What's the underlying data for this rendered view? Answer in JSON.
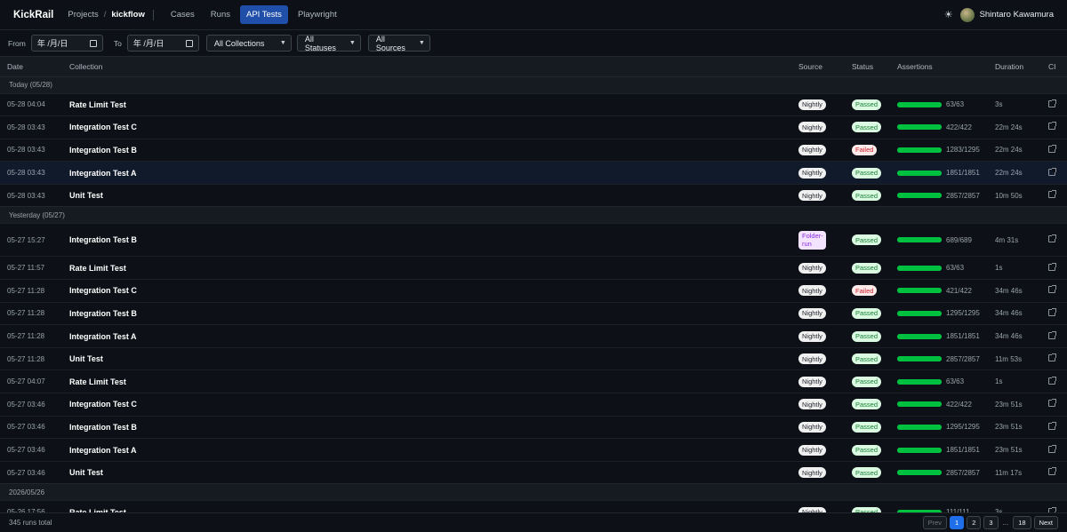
{
  "header": {
    "brand": "KickRail",
    "projects": "Projects",
    "sep": "/",
    "project": "kickflow",
    "nav": [
      "Cases",
      "Runs",
      "API Tests",
      "Playwright"
    ],
    "user": "Shintaro Kawamura"
  },
  "filters": {
    "from_label": "From",
    "from_value": "年 /月/日",
    "to_label": "To",
    "to_value": "年 /月/日",
    "collections": "All Collections",
    "statuses": "All Statuses",
    "sources": "All Sources"
  },
  "columns": [
    "Date",
    "Collection",
    "Source",
    "Status",
    "Assertions",
    "Duration",
    "CI"
  ],
  "groups": [
    {
      "label": "Today (05/28)",
      "rows": [
        {
          "date": "05-28 04:04",
          "collection": "Rate Limit Test",
          "source": "Nightly",
          "status": "Passed",
          "assertions": "63/63",
          "ratio": 1,
          "duration": "3s"
        },
        {
          "date": "05-28 03:43",
          "collection": "Integration Test C",
          "source": "Nightly",
          "status": "Passed",
          "assertions": "422/422",
          "ratio": 1,
          "duration": "22m 24s"
        },
        {
          "date": "05-28 03:43",
          "collection": "Integration Test B",
          "source": "Nightly",
          "status": "Failed",
          "assertions": "1283/1295",
          "ratio": 0.99,
          "duration": "22m 24s"
        },
        {
          "date": "05-28 03:43",
          "collection": "Integration Test A",
          "source": "Nightly",
          "status": "Passed",
          "assertions": "1851/1851",
          "ratio": 1,
          "duration": "22m 24s"
        },
        {
          "date": "05-28 03:43",
          "collection": "Unit Test",
          "source": "Nightly",
          "status": "Passed",
          "assertions": "2857/2857",
          "ratio": 1,
          "duration": "10m 50s"
        }
      ]
    },
    {
      "label": "Yesterday (05/27)",
      "rows": [
        {
          "date": "05-27 15:27",
          "collection": "Integration Test B",
          "source": "Folder-run",
          "status": "Passed",
          "assertions": "689/689",
          "ratio": 1,
          "duration": "4m 31s"
        },
        {
          "date": "05-27 11:57",
          "collection": "Rate Limit Test",
          "source": "Nightly",
          "status": "Passed",
          "assertions": "63/63",
          "ratio": 1,
          "duration": "1s"
        },
        {
          "date": "05-27 11:28",
          "collection": "Integration Test C",
          "source": "Nightly",
          "status": "Failed",
          "assertions": "421/422",
          "ratio": 0.998,
          "duration": "34m 46s"
        },
        {
          "date": "05-27 11:28",
          "collection": "Integration Test B",
          "source": "Nightly",
          "status": "Passed",
          "assertions": "1295/1295",
          "ratio": 1,
          "duration": "34m 46s"
        },
        {
          "date": "05-27 11:28",
          "collection": "Integration Test A",
          "source": "Nightly",
          "status": "Passed",
          "assertions": "1851/1851",
          "ratio": 1,
          "duration": "34m 46s"
        },
        {
          "date": "05-27 11:28",
          "collection": "Unit Test",
          "source": "Nightly",
          "status": "Passed",
          "assertions": "2857/2857",
          "ratio": 1,
          "duration": "11m 53s"
        },
        {
          "date": "05-27 04:07",
          "collection": "Rate Limit Test",
          "source": "Nightly",
          "status": "Passed",
          "assertions": "63/63",
          "ratio": 1,
          "duration": "1s"
        },
        {
          "date": "05-27 03:46",
          "collection": "Integration Test C",
          "source": "Nightly",
          "status": "Passed",
          "assertions": "422/422",
          "ratio": 1,
          "duration": "23m 51s"
        },
        {
          "date": "05-27 03:46",
          "collection": "Integration Test B",
          "source": "Nightly",
          "status": "Passed",
          "assertions": "1295/1295",
          "ratio": 1,
          "duration": "23m 51s"
        },
        {
          "date": "05-27 03:46",
          "collection": "Integration Test A",
          "source": "Nightly",
          "status": "Passed",
          "assertions": "1851/1851",
          "ratio": 1,
          "duration": "23m 51s"
        },
        {
          "date": "05-27 03:46",
          "collection": "Unit Test",
          "source": "Nightly",
          "status": "Passed",
          "assertions": "2857/2857",
          "ratio": 1,
          "duration": "11m 17s"
        }
      ]
    },
    {
      "label": "2026/05/26",
      "rows": [
        {
          "date": "05-26 17:56",
          "collection": "Rate Limit Test",
          "source": "Nightly",
          "status": "Passed",
          "assertions": "111/111",
          "ratio": 1,
          "duration": "3s"
        }
      ]
    }
  ],
  "footer": {
    "total": "345 runs total",
    "prev": "Prev",
    "pages": [
      "1",
      "2",
      "3"
    ],
    "ellipsis": "...",
    "last": "18",
    "next": "Next"
  },
  "colors": {
    "accent": "#1f4fa8",
    "pass_bar": "#00c040",
    "pass": "#1a7f37",
    "fail": "#cf222e"
  }
}
